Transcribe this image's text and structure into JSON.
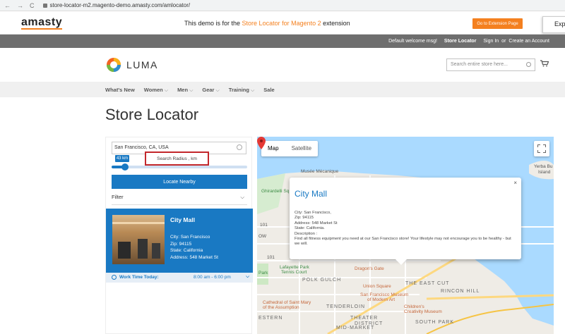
{
  "browser": {
    "url": "store-locator-m2.magento-demo.amasty.com/amlocator/",
    "nav": [
      "←",
      "→",
      "C"
    ]
  },
  "demobar": {
    "logo": "amasty",
    "text_before": "This demo is for the ",
    "highlight": "Store Locator for Magento 2",
    "text_after": " extension",
    "button": "Go to Extension Page",
    "side_tab": "Exp"
  },
  "toplinks": {
    "welcome": "Default welcome msg!",
    "store_locator": "Store Locator",
    "sign_in": "Sign In",
    "or": "or",
    "create_account": "Create an Account"
  },
  "header": {
    "logo": "LUMA",
    "search_placeholder": "Search entire store here..."
  },
  "nav": [
    {
      "label": "What's New",
      "dropdown": false
    },
    {
      "label": "Women",
      "dropdown": true
    },
    {
      "label": "Men",
      "dropdown": true
    },
    {
      "label": "Gear",
      "dropdown": true
    },
    {
      "label": "Training",
      "dropdown": true
    },
    {
      "label": "Sale",
      "dropdown": false
    }
  ],
  "page_title": "Store Locator",
  "locator": {
    "location_value": "San Francisco, CA, USA",
    "radius_badge": "43 km",
    "radius_label": "Search Radius , km",
    "radius_fraction": 0.1,
    "locate_button": "Locate Nearby",
    "filter_label": "Filter"
  },
  "store": {
    "name": "City Mall",
    "city": "City: San Francisco",
    "zip": "Zip: 94115",
    "state": "State: California",
    "address": "Address: 548 Market St",
    "work_label": "Work Time Today:",
    "work_hours": "8:00 am - 6:00 pm"
  },
  "map": {
    "tab_map": "Map",
    "tab_satellite": "Satellite",
    "info": {
      "title": "City Mall",
      "close": "×",
      "city": "City: San Francisco,",
      "zip": "Zip: 94115",
      "address": "Address: 548 Market St",
      "state": "State: California.",
      "description_label": "Description :",
      "description": "Find all fitness equipment you need at our San Francisco store! Your lifestyle may not encourage you to be healthy - but we will."
    },
    "labels": {
      "musee": "Musée Mécanique",
      "ghirardelli": "Ghirardelli Sq",
      "yerba1": "Yerba Bu",
      "yerba2": "Island",
      "lafayette1": "Lafayette Park",
      "lafayette2": "Tennis Court",
      "dragons": "Dragon's Gate",
      "polk": "POLK GULCH",
      "union": "Union Square",
      "eastcut": "THE EAST CUT",
      "rincon": "RINCON HILL",
      "stmary1": "Cathedral of Saint Mary",
      "stmary2": "of the Assumption",
      "sfmoma1": "San Francisco Museum",
      "sfmoma2": "of Modern Art",
      "tenderloin": "TENDERLOIN",
      "childrens1": "Children's",
      "childrens2": "Creativity Museum",
      "western": "ESTERN",
      "theater": "THEATER",
      "district": "DISTRICT",
      "southpark": "SOUTH PARK",
      "midmarket": "MID-MARKET",
      "park": "Park",
      "ow": "OW",
      "r101a": "101",
      "r101b": "101"
    }
  }
}
